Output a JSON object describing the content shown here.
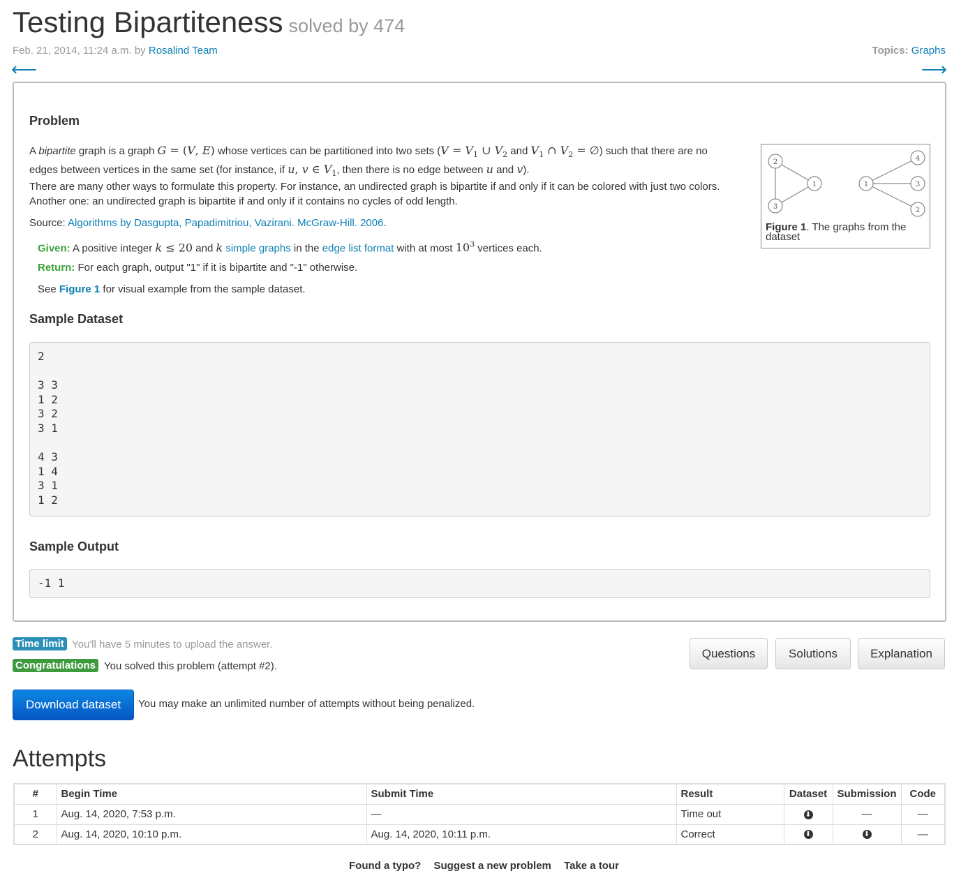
{
  "header": {
    "title": "Testing Bipartiteness",
    "solved_by": "solved by 474",
    "date": "Feb. 21, 2014, 11:24 a.m. by",
    "author": "Rosalind Team",
    "topics_label": "Topics:",
    "topic": "Graphs",
    "prev_arrow": "⟵",
    "next_arrow": "⟶"
  },
  "problem": {
    "heading": "Problem",
    "p1_a": "A",
    "p1_bipartite": "bipartite",
    "p1_b": "graph is a graph",
    "p1_c": "whose vertices can be partitioned into two sets (",
    "p1_d": ") such that there are no",
    "p1_e": "edges between vertices in the same set (for instance, if",
    "p1_f": ", then there is no edge between",
    "p1_g": "and",
    "p1_h": ").",
    "p2": "There are many other ways to formulate this property. For instance, an undirected graph is bipartite if and only if it can be colored with just two colors. Another one: an undirected graph is bipartite if and only if it contains no cycles of odd length.",
    "source_label": "Source:",
    "source_link": "Algorithms by Dasgupta, Papadimitriou, Vazirani. McGraw-Hill. 2006",
    "given_label": "Given:",
    "given_a": "A positive integer",
    "given_b": "and",
    "given_link1": "simple graphs",
    "given_c": "in the",
    "given_link2": "edge list format",
    "given_d": "with at most",
    "given_e": "vertices each.",
    "return_label": "Return:",
    "return_text": "For each graph, output \"1\" if it is bipartite and \"-1\" otherwise.",
    "see_a": "See",
    "see_link": "Figure 1",
    "see_b": "for visual example from the sample dataset."
  },
  "figure": {
    "caption_label": "Figure 1",
    "caption_text": ". The graphs from the dataset",
    "nodes_left": [
      "2",
      "1",
      "3"
    ],
    "nodes_right": [
      "4",
      "1",
      "3",
      "2"
    ]
  },
  "sample_dataset": {
    "heading": "Sample Dataset",
    "text": "2\n\n3 3\n1 2\n3 2\n3 1\n\n4 3\n1 4\n3 1\n1 2"
  },
  "sample_output": {
    "heading": "Sample Output",
    "text": "-1 1"
  },
  "status": {
    "time_label": "Time limit",
    "time_text": "You'll have 5 minutes to upload the answer.",
    "congrats_label": "Congratulations",
    "congrats_text": "You solved this problem (attempt #2)."
  },
  "buttons": {
    "questions": "Questions",
    "solutions": "Solutions",
    "explanation": "Explanation",
    "download": "Download dataset",
    "download_note": "You may make an unlimited number of attempts without being penalized."
  },
  "attempts": {
    "heading": "Attempts",
    "columns": [
      "#",
      "Begin Time",
      "Submit Time",
      "Result",
      "Dataset",
      "Submission",
      "Code"
    ],
    "rows": [
      {
        "num": "1",
        "begin": "Aug. 14, 2020, 7:53 p.m.",
        "submit": "—",
        "result": "Time out",
        "submission": "—",
        "code": "—"
      },
      {
        "num": "2",
        "begin": "Aug. 14, 2020, 10:10 p.m.",
        "submit": "Aug. 14, 2020, 10:11 p.m.",
        "result": "Correct",
        "code": "—"
      }
    ]
  },
  "footer": {
    "typo": "Found a typo?",
    "suggest": "Suggest a new problem",
    "tour": "Take a tour"
  }
}
